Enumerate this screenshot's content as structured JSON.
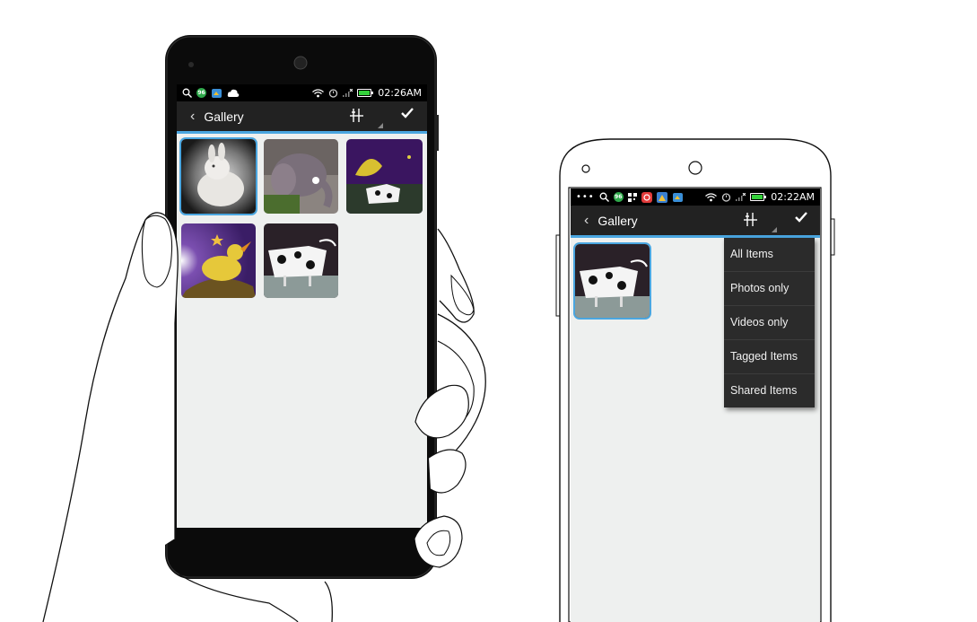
{
  "status_bar": {
    "time_left_phone": "02:26AM",
    "time_right_phone": "02:22AM",
    "notification_badge": "96"
  },
  "left_phone": {
    "app_title": "Gallery",
    "thumbnails": [
      "bunny-photo",
      "elephant-photo",
      "bird-cow-photo",
      "bird-photo",
      "cow-photo"
    ]
  },
  "right_phone": {
    "app_title": "Gallery",
    "thumbnails": [
      "cow-photo"
    ],
    "filter_menu": {
      "items": [
        "All Items",
        "Photos only",
        "Videos only",
        "Tagged Items",
        "Shared Items"
      ]
    }
  },
  "colors": {
    "action_bar": "#222222",
    "accent": "#4aa6e0",
    "screen_bg": "#eef0ef",
    "menu_bg": "#2b2b2b"
  }
}
